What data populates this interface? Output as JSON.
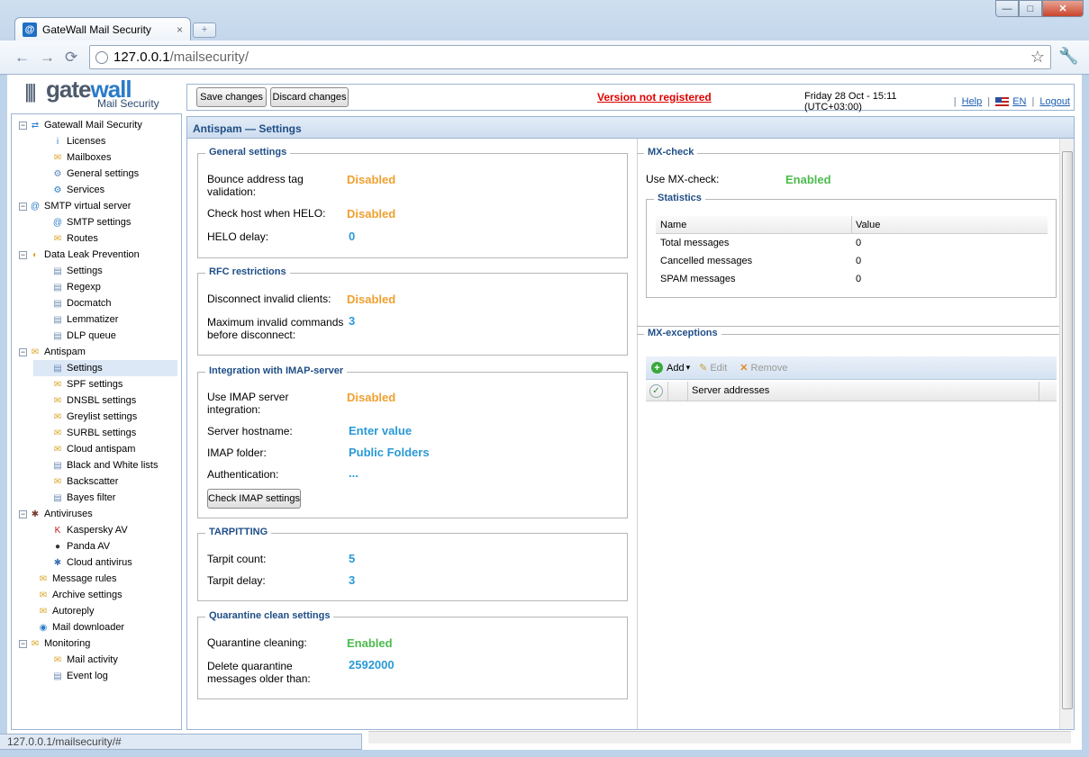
{
  "browser": {
    "tab_title": "GateWall Mail Security",
    "tab_close": "×",
    "new_tab": "+",
    "url_host": "127.0.0.1",
    "url_path": "/mailsecurity/",
    "status_url": "127.0.0.1/mailsecurity/#",
    "back": "←",
    "forward": "→",
    "reload": "⟳",
    "bookmark": "☆",
    "wrench": "🔧",
    "min": "—",
    "max": "□",
    "close": "✕"
  },
  "logo": {
    "bars": "||||",
    "brand_gate": "gate",
    "brand_wall": "wall",
    "product": "Mail Security"
  },
  "topbar": {
    "save": "Save changes",
    "discard": "Discard changes",
    "warning": "Version not registered",
    "datetime": "Friday 28 Oct - 15:11 (UTC+03:00)",
    "help": "Help",
    "lang": "EN",
    "logout": "Logout",
    "sep": "|"
  },
  "tree": [
    {
      "label": "Gatewall Mail Security",
      "exp": "−",
      "icon": "⇄"
    },
    {
      "label": "Licenses",
      "icon": "i"
    },
    {
      "label": "Mailboxes",
      "icon": "✉"
    },
    {
      "label": "General settings",
      "icon": "⚙"
    },
    {
      "label": "Services",
      "icon": "⚙"
    },
    {
      "label": "SMTP virtual server",
      "exp": "−",
      "icon": "@"
    },
    {
      "label": "SMTP settings",
      "icon": "@"
    },
    {
      "label": "Routes",
      "icon": "✉"
    },
    {
      "label": "Data Leak Prevention",
      "exp": "−",
      "icon": "◐"
    },
    {
      "label": "Settings",
      "icon": "▤"
    },
    {
      "label": "Regexp",
      "icon": "▤"
    },
    {
      "label": "Docmatch",
      "icon": "▤"
    },
    {
      "label": "Lemmatizer",
      "icon": "▤"
    },
    {
      "label": "DLP queue",
      "icon": "▤"
    },
    {
      "label": "Antispam",
      "exp": "−",
      "icon": "✉"
    },
    {
      "label": "Settings",
      "icon": "▤"
    },
    {
      "label": "SPF settings",
      "icon": "✉"
    },
    {
      "label": "DNSBL settings",
      "icon": "✉"
    },
    {
      "label": "Greylist settings",
      "icon": "✉"
    },
    {
      "label": "SURBL settings",
      "icon": "✉"
    },
    {
      "label": "Cloud antispam",
      "icon": "✉"
    },
    {
      "label": "Black and White lists",
      "icon": "▤"
    },
    {
      "label": "Backscatter",
      "icon": "✉"
    },
    {
      "label": "Bayes filter",
      "icon": "▤"
    },
    {
      "label": "Antiviruses",
      "exp": "−",
      "icon": "✱"
    },
    {
      "label": "Kaspersky AV",
      "icon": "K"
    },
    {
      "label": "Panda AV",
      "icon": "●"
    },
    {
      "label": "Cloud antivirus",
      "icon": "✱"
    },
    {
      "label": "Message rules",
      "icon": "✉"
    },
    {
      "label": "Archive settings",
      "icon": "✉"
    },
    {
      "label": "Autoreply",
      "icon": "✉"
    },
    {
      "label": "Mail downloader",
      "icon": "◉"
    },
    {
      "label": "Monitoring",
      "exp": "−",
      "icon": "✉"
    },
    {
      "label": "Mail activity",
      "icon": "✉"
    },
    {
      "label": "Event log",
      "icon": "▤"
    }
  ],
  "panel": {
    "title": "Antispam — Settings",
    "general": {
      "legend": "General settings",
      "bounce_label": "Bounce address tag validation:",
      "bounce_val": "Disabled",
      "helo_check_label": "Check host when HELO:",
      "helo_check_val": "Disabled",
      "helo_delay_label": "HELO delay:",
      "helo_delay_val": "0"
    },
    "rfc": {
      "legend": "RFC restrictions",
      "disconnect_label": "Disconnect invalid clients:",
      "disconnect_val": "Disabled",
      "maxinvalid_label": "Maximum invalid commands before disconnect:",
      "maxinvalid_val": "3"
    },
    "imap": {
      "legend": "Integration with IMAP-server",
      "use_label": "Use IMAP server integration:",
      "use_val": "Disabled",
      "host_label": "Server hostname:",
      "host_val": "Enter value",
      "folder_label": "IMAP folder:",
      "folder_val": "Public Folders",
      "auth_label": "Authentication:",
      "auth_val": "...",
      "check_btn": "Check IMAP settings"
    },
    "tarpit": {
      "legend": "TARPITTING",
      "count_label": "Tarpit count:",
      "count_val": "5",
      "delay_label": "Tarpit delay:",
      "delay_val": "3"
    },
    "quarantine": {
      "legend": "Quarantine clean settings",
      "clean_label": "Quarantine cleaning:",
      "clean_val": "Enabled",
      "older_label": "Delete quarantine messages older than:",
      "older_val": "2592000"
    },
    "mx": {
      "legend": "MX-check",
      "use_label": "Use MX-check:",
      "use_val": "Enabled",
      "stats_legend": "Statistics",
      "col_name": "Name",
      "col_value": "Value",
      "rows": [
        {
          "name": "Total messages",
          "value": "0"
        },
        {
          "name": "Cancelled messages",
          "value": "0"
        },
        {
          "name": "SPAM messages",
          "value": "0"
        }
      ]
    },
    "mxex": {
      "legend": "MX-exceptions",
      "add": "Add",
      "edit": "Edit",
      "remove": "Remove",
      "col": "Server addresses",
      "add_icon": "+",
      "edit_icon": "✎",
      "remove_icon": "✕",
      "check_icon": "✓",
      "caret": "▾"
    }
  },
  "colors": {
    "disabled": "#f0a030",
    "enabled": "#4cbb4c",
    "number": "#2a9ad6",
    "warning": "#e00000",
    "header_text": "#1f4e86"
  }
}
